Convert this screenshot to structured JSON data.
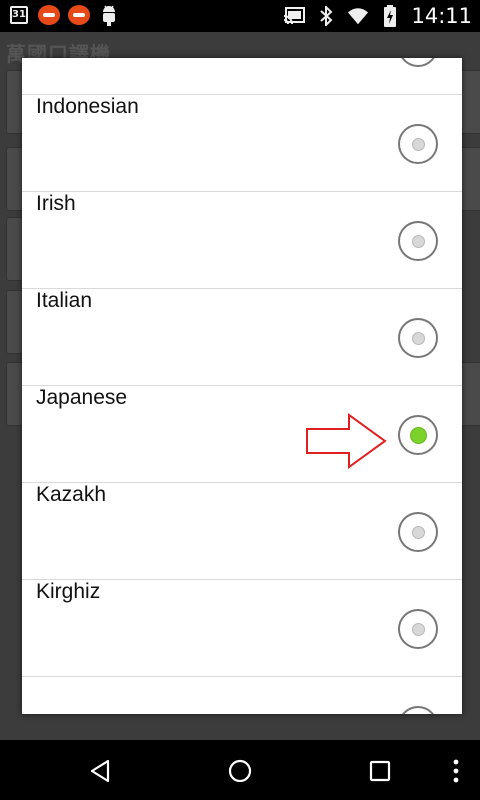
{
  "status_bar": {
    "calendar_day": "31",
    "time": "14:11",
    "icons": [
      "calendar-icon",
      "app-notification-icon",
      "app-notification-icon",
      "android-debug-icon",
      "cast-icon",
      "bluetooth-icon",
      "wifi-icon",
      "battery-charging-icon"
    ]
  },
  "app": {
    "title": "萬國口譯機"
  },
  "dialog": {
    "options": [
      {
        "label": "",
        "checked": false
      },
      {
        "label": "Indonesian",
        "checked": false
      },
      {
        "label": "Irish",
        "checked": false
      },
      {
        "label": "Italian",
        "checked": false
      },
      {
        "label": "Japanese",
        "checked": true
      },
      {
        "label": "Kazakh",
        "checked": false
      },
      {
        "label": "Kirghiz",
        "checked": false
      },
      {
        "label": "",
        "checked": false
      }
    ],
    "accent_color": "#7cd12b",
    "annotation_arrow_color": "#e02020"
  },
  "nav_bar": {
    "buttons": [
      "back-icon",
      "home-icon",
      "recents-icon",
      "overflow-menu-icon"
    ]
  }
}
